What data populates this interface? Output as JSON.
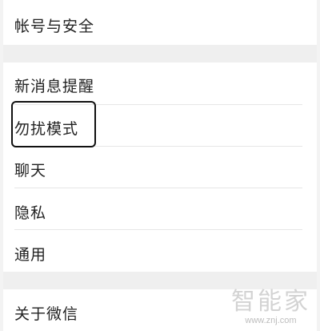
{
  "settings": {
    "items": [
      {
        "label": "帐号与安全"
      },
      {
        "label": "新消息提醒"
      },
      {
        "label": "勿扰模式"
      },
      {
        "label": "聊天"
      },
      {
        "label": "隐私"
      },
      {
        "label": "通用"
      },
      {
        "label": "关于微信"
      }
    ]
  },
  "highlight": {
    "target": "勿扰模式"
  },
  "watermark": {
    "brand": "智能家",
    "url": "www.znj.com"
  },
  "colors": {
    "background": "#ffffff",
    "group_gap": "#efefef",
    "divider": "#e6e6e6",
    "text": "#222222",
    "highlight_border": "#111111"
  }
}
